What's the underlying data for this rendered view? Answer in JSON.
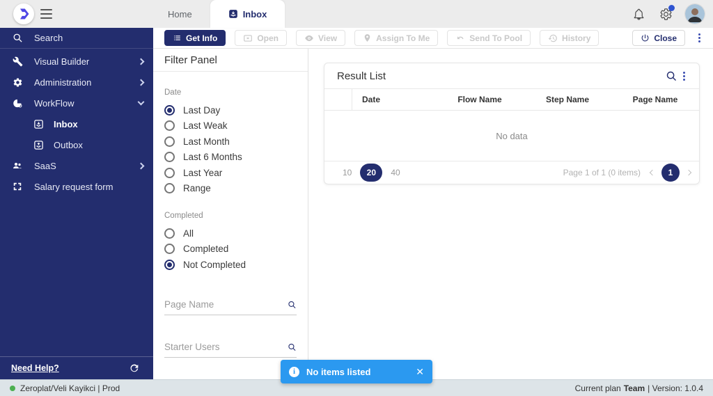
{
  "topbar": {
    "tabs": [
      {
        "label": "Home",
        "active": false
      },
      {
        "label": "Inbox",
        "active": true
      }
    ]
  },
  "toolbar": {
    "buttons": [
      {
        "label": "Get Info",
        "state": "primary"
      },
      {
        "label": "Open",
        "state": "disabled"
      },
      {
        "label": "View",
        "state": "disabled"
      },
      {
        "label": "Assign To Me",
        "state": "disabled"
      },
      {
        "label": "Send To Pool",
        "state": "disabled"
      },
      {
        "label": "History",
        "state": "disabled"
      }
    ],
    "close_label": "Close"
  },
  "sidebar": {
    "items": [
      {
        "label": "Search"
      },
      {
        "label": "Visual Builder",
        "chevron": "right"
      },
      {
        "label": "Administration",
        "chevron": "right"
      },
      {
        "label": "WorkFlow",
        "chevron": "down",
        "expanded": true
      },
      {
        "label": "Inbox",
        "child": true,
        "active": true
      },
      {
        "label": "Outbox",
        "child": true
      },
      {
        "label": "SaaS",
        "chevron": "right"
      },
      {
        "label": "Salary request form"
      }
    ],
    "need_help": "Need Help?"
  },
  "filter_panel": {
    "title": "Filter Panel",
    "date_label": "Date",
    "date_options": [
      "Last Day",
      "Last Weak",
      "Last Month",
      "Last 6 Months",
      "Last Year",
      "Range"
    ],
    "date_selected_index": 0,
    "completed_label": "Completed",
    "completed_options": [
      "All",
      "Completed",
      "Not Completed"
    ],
    "completed_selected_index": 2,
    "page_name_placeholder": "Page Name",
    "starter_users_placeholder": "Starter Users"
  },
  "result_list": {
    "title": "Result List",
    "columns": [
      "Date",
      "Flow Name",
      "Step Name",
      "Page Name"
    ],
    "empty_text": "No data",
    "page_sizes": [
      "10",
      "20",
      "40"
    ],
    "page_size_selected": "20",
    "page_info": "Page 1 of 1 (0 items)",
    "current_page": "1"
  },
  "toast": {
    "message": "No items listed"
  },
  "statusbar": {
    "environment": "Zeroplat/Veli Kayikci | Prod",
    "plan_prefix": "Current plan",
    "plan": "Team",
    "version_suffix": "| Version: 1.0.4"
  },
  "colors": {
    "sidebar_navy": "#232d6e",
    "accent_navy": "#232d6e",
    "toast_blue": "#2b99f0",
    "notification_badge_blue": "#2f54d1",
    "status_green": "#4caf50",
    "topbar_gray": "#ececec",
    "statusbar_gray": "#dde4e8",
    "logo_indigo": "#4f46e5"
  }
}
